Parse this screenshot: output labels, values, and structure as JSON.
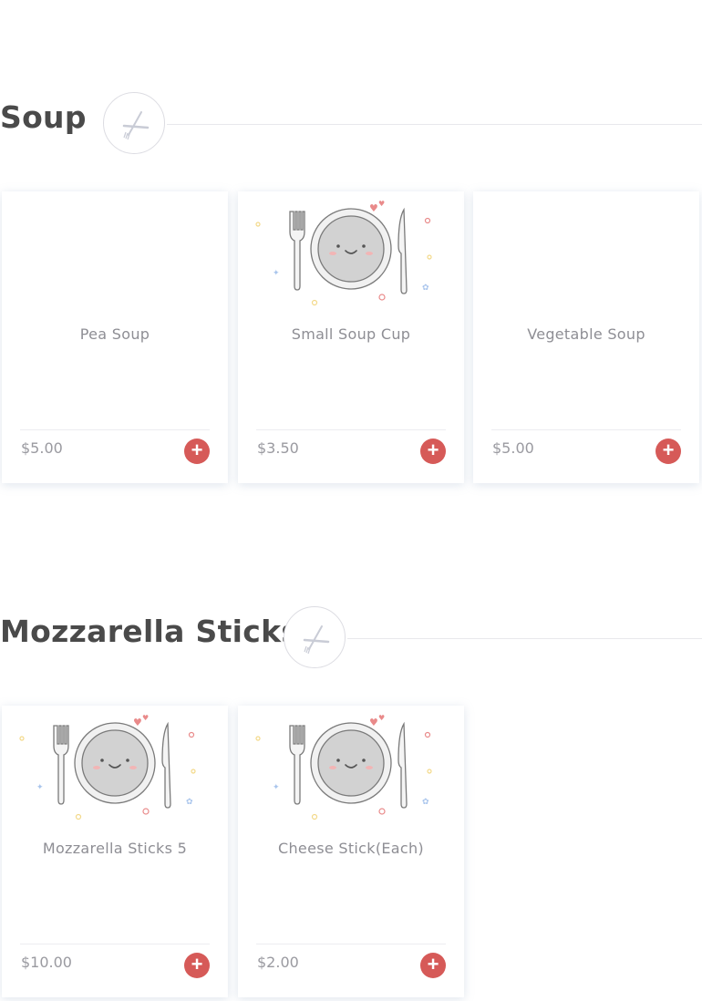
{
  "colors": {
    "accent": "#d65a58",
    "title": "#4a4a4a",
    "muted": "#8e8e94"
  },
  "sections": [
    {
      "title": "Soup",
      "icon": "fork-knife-icon",
      "items": [
        {
          "name": "Pea Soup",
          "price": "$5.00",
          "has_image": false
        },
        {
          "name": "Small Soup Cup",
          "price": "$3.50",
          "has_image": true
        },
        {
          "name": "Vegetable Soup",
          "price": "$5.00",
          "has_image": false
        }
      ]
    },
    {
      "title": "Mozzarella Sticks",
      "icon": "fork-knife-icon",
      "items": [
        {
          "name": "Mozzarella Sticks 5",
          "price": "$10.00",
          "has_image": true
        },
        {
          "name": "Cheese Stick(Each)",
          "price": "$2.00",
          "has_image": true
        }
      ]
    }
  ],
  "add_button_icon": "plus-icon",
  "placeholder_icon": "smiling-plate-icon"
}
